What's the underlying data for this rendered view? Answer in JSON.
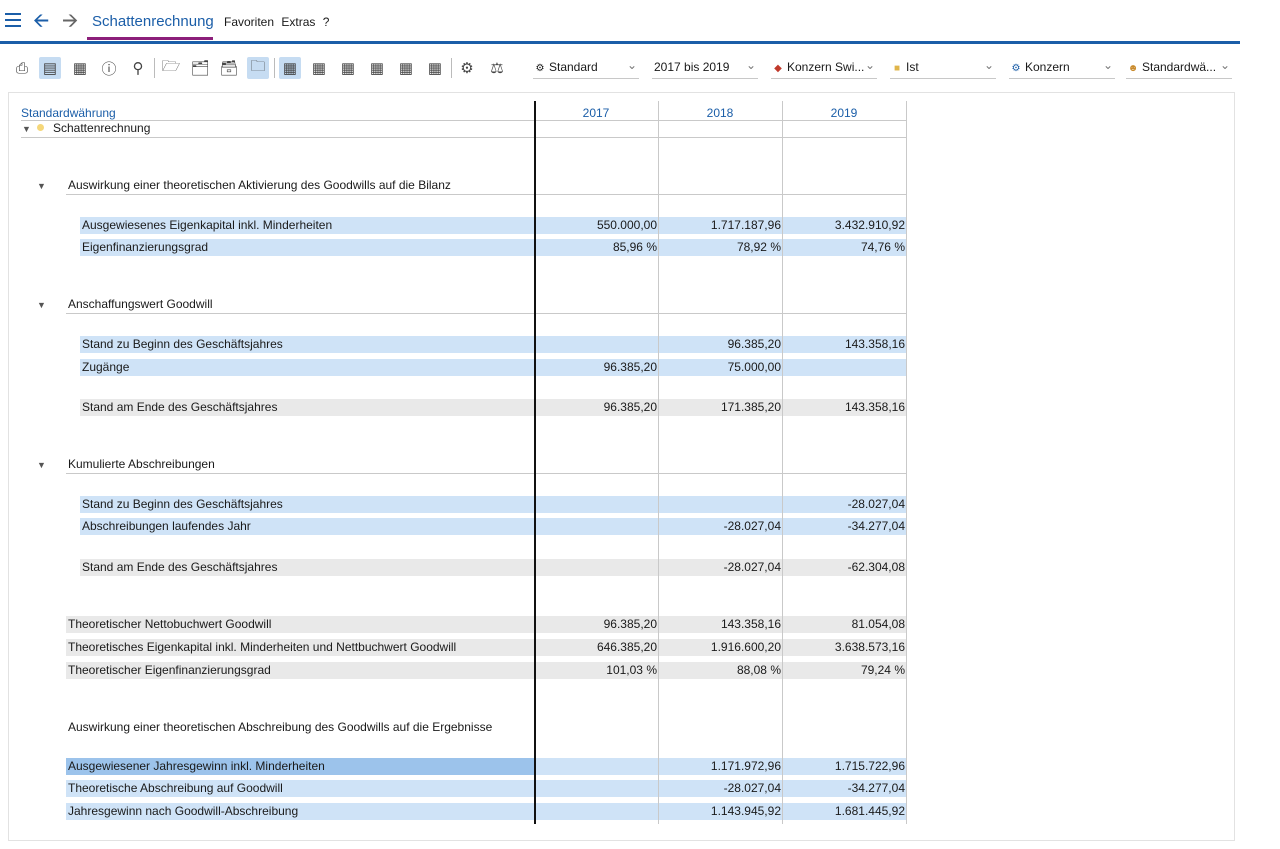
{
  "titlebar": {
    "app_tab": "Schattenrechnung",
    "menu": [
      "Favoriten",
      "Extras",
      "?"
    ]
  },
  "toolbar": {
    "icons": [
      "print-icon",
      "layout-icon",
      "preview-icon",
      "help-icon",
      "search-icon",
      "folder-open-icon",
      "folder-export-icon",
      "folder-settings-icon",
      "folder-active-icon",
      "table-view-1-icon",
      "table-view-2-icon",
      "table-view-3-icon",
      "table-view-4-icon",
      "table-view-5-icon",
      "table-view-6-icon",
      "settings-gears-icon",
      "balance-icon"
    ],
    "dropdowns": [
      {
        "icon": "gear",
        "value": "Standard"
      },
      {
        "icon": "",
        "value": "2017 bis 2019"
      },
      {
        "icon": "diamond",
        "value": "Konzern Swi..."
      },
      {
        "icon": "square",
        "value": "Ist"
      },
      {
        "icon": "gear",
        "value": "Konzern"
      },
      {
        "icon": "user",
        "value": "Standardwä..."
      }
    ]
  },
  "report": {
    "header_label": "Standardwährung",
    "columns": [
      "2017",
      "2018",
      "2019"
    ],
    "root": "Schattenrechnung",
    "sections": [
      {
        "title": "Auswirkung einer theoretischen Aktivierung des Goodwills auf die Bilanz"
      },
      {
        "title": "Anschaffungswert Goodwill"
      },
      {
        "title": "Kumulierte Abschreibungen"
      },
      {
        "title": "Auswirkung einer theoretischen Abschreibung des Goodwills auf die Ergebnisse"
      }
    ],
    "rows": [
      {
        "label": "Ausgewiesenes Eigenkapital inkl. Minderheiten",
        "values": [
          "550.000,00",
          "1.717.187,96",
          "3.432.910,92"
        ]
      },
      {
        "label": "Eigenfinanzierungsgrad",
        "values": [
          "85,96 %",
          "78,92 %",
          "74,76 %"
        ]
      },
      {
        "label": "Stand zu Beginn des Geschäftsjahres",
        "values": [
          "",
          "96.385,20",
          "143.358,16"
        ]
      },
      {
        "label": "Zugänge",
        "values": [
          "96.385,20",
          "75.000,00",
          ""
        ]
      },
      {
        "label": "Stand am Ende des Geschäftsjahres",
        "values": [
          "96.385,20",
          "171.385,20",
          "143.358,16"
        ]
      },
      {
        "label": "Stand zu Beginn des Geschäftsjahres",
        "values": [
          "",
          "",
          "-28.027,04"
        ]
      },
      {
        "label": "Abschreibungen laufendes Jahr",
        "values": [
          "",
          "-28.027,04",
          "-34.277,04"
        ]
      },
      {
        "label": "Stand am Ende des Geschäftsjahres",
        "values": [
          "",
          "-28.027,04",
          "-62.304,08"
        ]
      },
      {
        "label": "Theoretischer Nettobuchwert Goodwill",
        "values": [
          "96.385,20",
          "143.358,16",
          "81.054,08"
        ]
      },
      {
        "label": "Theoretisches Eigenkapital inkl. Minderheiten und Nettbuchwert Goodwill",
        "values": [
          "646.385,20",
          "1.916.600,20",
          "3.638.573,16"
        ]
      },
      {
        "label": "Theoretischer Eigenfinanzierungsgrad",
        "values": [
          "101,03 %",
          "88,08 %",
          "79,24 %"
        ]
      },
      {
        "label": "Ausgewiesener Jahresgewinn inkl. Minderheiten",
        "values": [
          "",
          "1.171.972,96",
          "1.715.722,96"
        ]
      },
      {
        "label": "Theoretische Abschreibung auf Goodwill",
        "values": [
          "",
          "-28.027,04",
          "-34.277,04"
        ]
      },
      {
        "label": "Jahresgewinn nach Goodwill-Abschreibung",
        "values": [
          "",
          "1.143.945,92",
          "1.681.445,92"
        ]
      }
    ]
  }
}
